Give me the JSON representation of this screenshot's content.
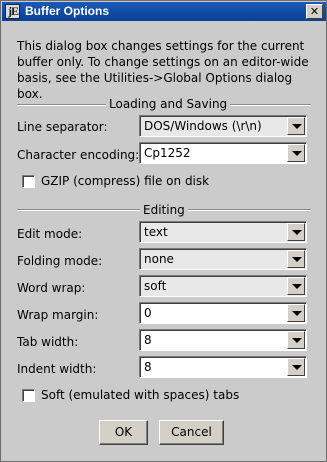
{
  "window": {
    "title": "Buffer Options",
    "close_glyph": "✕",
    "icon_glyph": "jE"
  },
  "description": "This dialog box changes settings for the current buffer only. To change settings on an editor-wide basis, see the Utilities->Global Options dialog box.",
  "loading": {
    "title": "Loading and Saving",
    "line_separator": {
      "label": "Line separator:",
      "value": "DOS/Windows (\\r\\n)"
    },
    "encoding": {
      "label": "Character encoding:",
      "value": "Cp1252"
    },
    "gzip": {
      "label": "GZIP (compress) file on disk",
      "checked": false
    }
  },
  "editing": {
    "title": "Editing",
    "edit_mode": {
      "label": "Edit mode:",
      "value": "text"
    },
    "folding_mode": {
      "label": "Folding mode:",
      "value": "none"
    },
    "word_wrap": {
      "label": "Word wrap:",
      "value": "soft"
    },
    "wrap_margin": {
      "label": "Wrap margin:",
      "value": "0"
    },
    "tab_width": {
      "label": "Tab width:",
      "value": "8"
    },
    "indent_width": {
      "label": "Indent width:",
      "value": "8"
    },
    "soft_tabs": {
      "label": "Soft (emulated with spaces) tabs",
      "checked": false
    }
  },
  "buttons": {
    "ok": "OK",
    "cancel": "Cancel"
  }
}
